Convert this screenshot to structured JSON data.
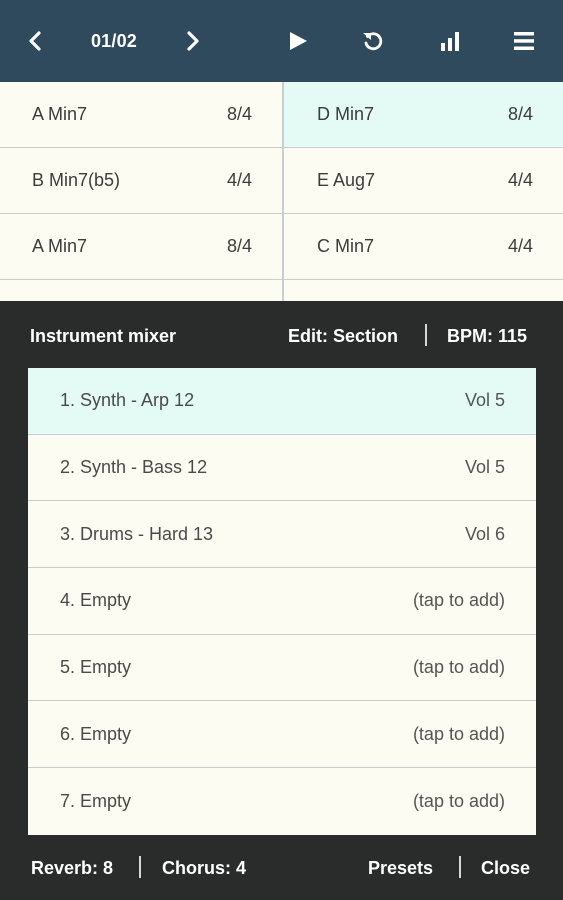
{
  "topbar": {
    "page_indicator": "01/02",
    "icons": [
      "chevron-left-icon",
      "chevron-right-icon",
      "play-icon",
      "undo-icon",
      "bar-chart-icon",
      "hamburger-menu-icon"
    ]
  },
  "grid": {
    "rows": [
      {
        "left": {
          "chord": "A Min7",
          "meter": "8/4"
        },
        "right": {
          "chord": "D Min7",
          "meter": "8/4",
          "active": true
        }
      },
      {
        "left": {
          "chord": "B Min7(b5)",
          "meter": "4/4"
        },
        "right": {
          "chord": "E Aug7",
          "meter": "4/4"
        }
      },
      {
        "left": {
          "chord": "A Min7",
          "meter": "8/4"
        },
        "right": {
          "chord": "C Min7",
          "meter": "4/4"
        }
      }
    ]
  },
  "mixer": {
    "title": "Instrument mixer",
    "edit_label": "Edit: Section",
    "bpm_label": "BPM: 115",
    "instruments": [
      {
        "name": "1. Synth - Arp 12",
        "value": "Vol 5",
        "active": true
      },
      {
        "name": "2. Synth - Bass 12",
        "value": "Vol 5"
      },
      {
        "name": "3. Drums - Hard 13",
        "value": "Vol 6"
      },
      {
        "name": "4. Empty",
        "value": "(tap to add)"
      },
      {
        "name": "5. Empty",
        "value": "(tap to add)"
      },
      {
        "name": "6. Empty",
        "value": "(tap to add)"
      },
      {
        "name": "7. Empty",
        "value": "(tap to add)"
      }
    ]
  },
  "footer": {
    "reverb_label": "Reverb: 8",
    "chorus_label": "Chorus: 4",
    "presets_label": "Presets",
    "close_label": "Close"
  },
  "colors": {
    "topbar": "#2e4a5c",
    "panel": "#2a2b2b",
    "cell": "#fcfcf3",
    "active": "#e3fbf4"
  }
}
